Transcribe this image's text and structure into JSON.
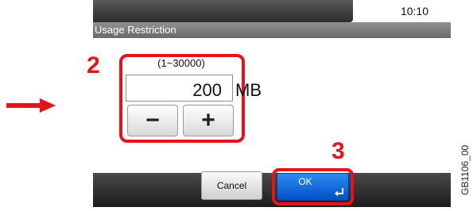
{
  "header": {
    "clock": "10:10"
  },
  "title": "Usage Restriction",
  "input": {
    "range": "(1~30000)",
    "value": "200",
    "unit": "MB",
    "minus_symbol": "−",
    "plus_symbol": "+"
  },
  "callouts": {
    "step_2": "2",
    "step_3": "3"
  },
  "footer": {
    "cancel_label": "Cancel",
    "ok_label": "OK"
  },
  "figure_code": "GB1106_00",
  "icons": [
    "right-arrow-icon",
    "minus-icon",
    "plus-icon",
    "enter-icon"
  ],
  "colors": {
    "callout_red": "#e3141b",
    "ok_blue": "#1a6fe0"
  }
}
